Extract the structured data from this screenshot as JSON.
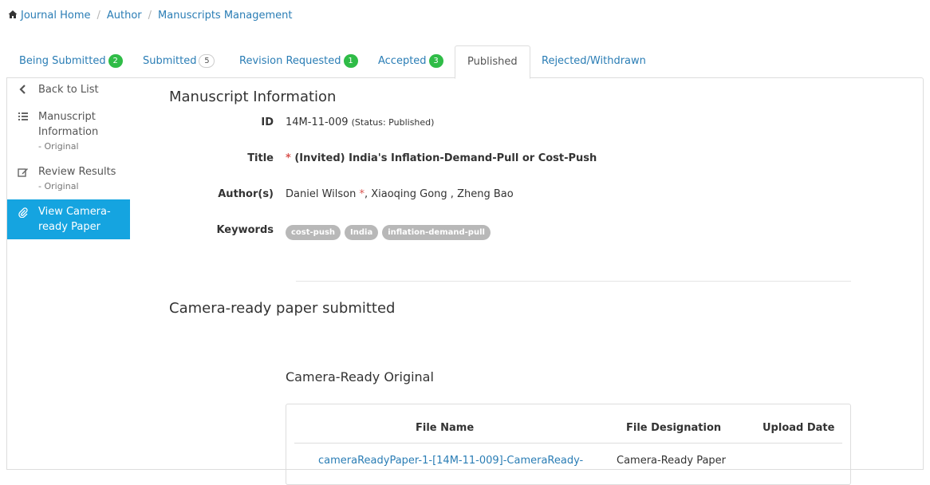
{
  "breadcrumb": {
    "items": [
      "Journal Home",
      "Author",
      "Manuscripts Management"
    ],
    "separator": "/"
  },
  "tabs": [
    {
      "label": "Being Submitted",
      "count": "2",
      "badge": "green"
    },
    {
      "label": "Submitted",
      "count": "5",
      "badge": "outline"
    },
    {
      "label": "Revision Requested",
      "count": "1",
      "badge": "green"
    },
    {
      "label": "Accepted",
      "count": "3",
      "badge": "green"
    },
    {
      "label": "Published",
      "count": "",
      "active": true
    },
    {
      "label": "Rejected/Withdrawn",
      "count": ""
    }
  ],
  "sidebar": {
    "back": "Back to List",
    "items": [
      {
        "label": "Manuscript Information",
        "sub": "- Original",
        "icon": "list-icon"
      },
      {
        "label": "Review Results",
        "sub": "- Original",
        "icon": "edit-icon"
      },
      {
        "label": "View Camera-ready Paper",
        "sub": "",
        "icon": "paperclip-icon",
        "active": true
      }
    ]
  },
  "manuscript": {
    "heading": "Manuscript Information",
    "id_label": "ID",
    "id_value": "14M-11-009",
    "status": "(Status: Published)",
    "title_label": "Title",
    "title_marker": "*",
    "title_value": "(Invited) India's Inflation-Demand-Pull or Cost-Push",
    "authors_label": "Author(s)",
    "author_first": "Daniel Wilson",
    "author_first_marker": "*",
    "authors_rest": ", Xiaoqing Gong , Zheng Bao",
    "keywords_label": "Keywords",
    "keywords": [
      "cost-push",
      "India",
      "inflation-demand-pull"
    ]
  },
  "camera_ready": {
    "heading": "Camera-ready paper submitted",
    "subheading": "Camera-Ready Original",
    "columns": [
      "File Name",
      "File Designation",
      "Upload Date"
    ],
    "rows": [
      {
        "file_name": "cameraReadyPaper-1-[14M-11-009]-CameraReady-",
        "designation": "Camera-Ready Paper",
        "upload_date": ""
      }
    ]
  },
  "colors": {
    "link": "#2a7db5",
    "badge_green": "#2fbc47",
    "sidebar_active": "#15a4e0",
    "keyword_tag": "#b8b8b8",
    "required_marker": "#d9534f"
  }
}
